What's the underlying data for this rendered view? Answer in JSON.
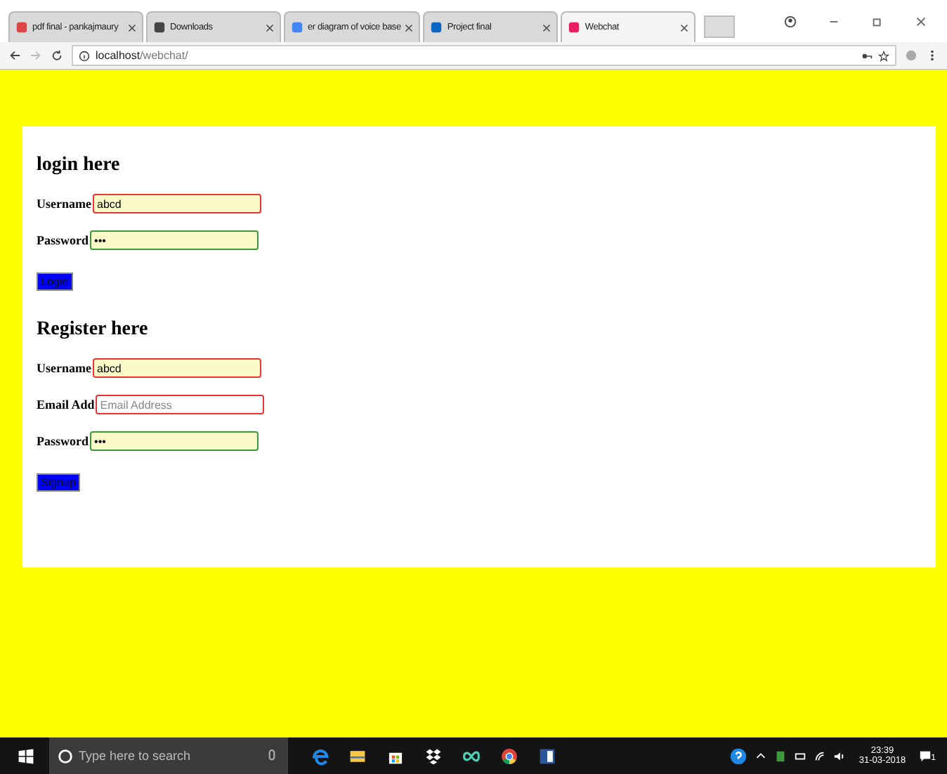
{
  "browser": {
    "tabs": [
      {
        "title": "pdf final - pankajmaury",
        "selected": false
      },
      {
        "title": "Downloads",
        "selected": false
      },
      {
        "title": "er diagram of voice base",
        "selected": false
      },
      {
        "title": "Project final",
        "selected": false
      },
      {
        "title": "Webchat",
        "selected": true
      }
    ],
    "address": {
      "host": "localhost",
      "path": "/webchat/"
    }
  },
  "login": {
    "heading": "login here",
    "fields": [
      {
        "label": "Username",
        "value": "abcd",
        "valid": false,
        "autofilled": true
      },
      {
        "label": "Password",
        "value": "•••",
        "valid": true,
        "autofilled": true
      }
    ],
    "button": "Login"
  },
  "register": {
    "heading": "Register here",
    "fields": [
      {
        "label": "Username",
        "value": "abcd",
        "valid": false,
        "autofilled": true
      },
      {
        "label": "Email Add",
        "placeholder": "Email Address",
        "valid": false,
        "autofilled": false
      },
      {
        "label": "Password",
        "value": "•••",
        "valid": true,
        "autofilled": true
      }
    ],
    "button": "Signup"
  },
  "taskbar": {
    "search_placeholder": "Type here to search",
    "time": "23:39",
    "date": "31-03-2018",
    "notifications": "1"
  }
}
